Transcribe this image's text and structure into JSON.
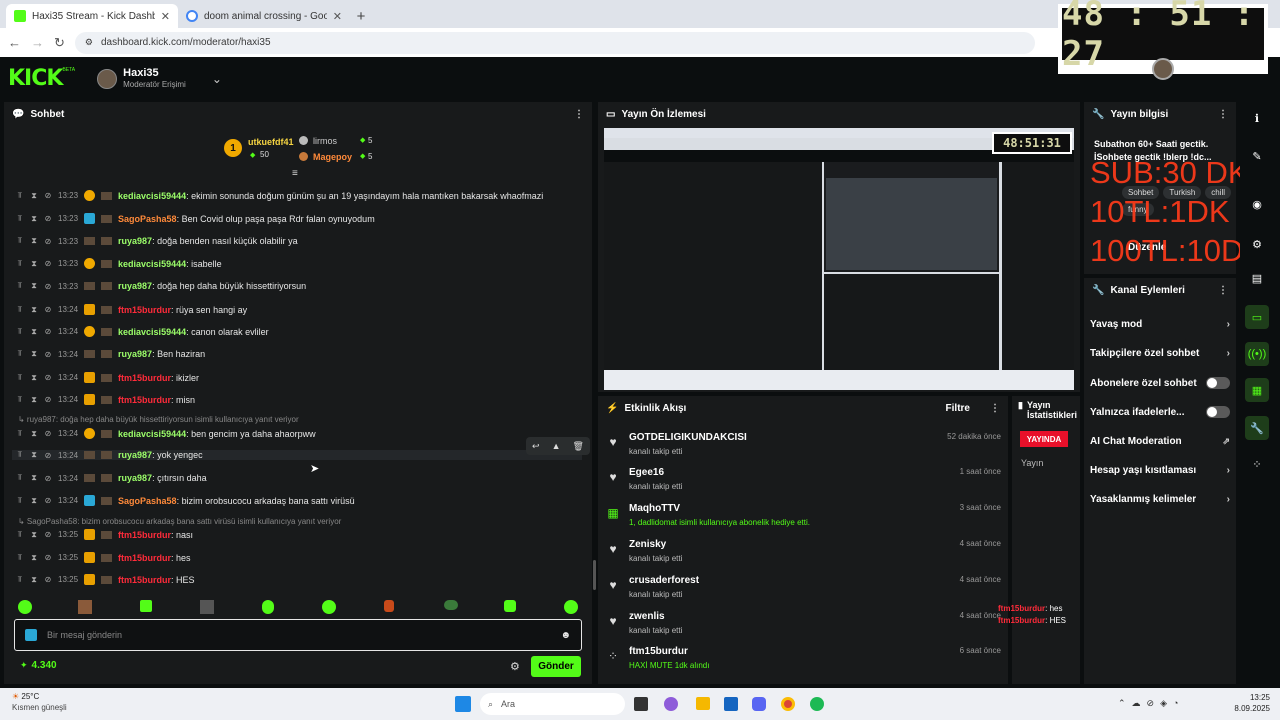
{
  "browser": {
    "tabs": [
      {
        "title": "Haxi35 Stream - Kick Dashboar",
        "active": true
      },
      {
        "title": "doom animal crossing - Google",
        "active": false
      }
    ],
    "url": "dashboard.kick.com/moderator/haxi35"
  },
  "header": {
    "logo": "KICK",
    "beta": "BETA",
    "username": "Haxi35",
    "role": "Moderatör Erişimi"
  },
  "timer": "48 : 51 : 27",
  "chat": {
    "title": "Sohbet",
    "leaders": [
      {
        "name": "utkuefdf41",
        "count": "50",
        "rank": "1"
      },
      {
        "name": "lirmos",
        "count": "5"
      },
      {
        "name": "Magepoy",
        "count": "5"
      }
    ],
    "messages": [
      {
        "time": "13:23",
        "user": "kediavcisi59444",
        "text": ": ekimin sonunda doğum günüm şu an 19 yaşındayım hala mantıken bakarsak whaofmazi"
      },
      {
        "time": "13:23",
        "user": "SagoPasha58",
        "text": ": Ben Covid olup paşa paşa Rdr falan oynuyodum"
      },
      {
        "time": "13:23",
        "user": "ruya987",
        "text": ": doğa benden nasıl küçük olabilir ya"
      },
      {
        "time": "13:23",
        "user": "kediavcisi59444",
        "text": ": isabelle"
      },
      {
        "time": "13:23",
        "user": "ruya987",
        "text": ": doğa hep daha büyük hissettiriyorsun"
      },
      {
        "time": "13:24",
        "user": "ftm15burdur",
        "text": ": rüya sen hangi ay"
      },
      {
        "time": "13:24",
        "user": "kediavcisi59444",
        "text": ": canon olarak evliler"
      },
      {
        "time": "13:24",
        "user": "ruya987",
        "text": ": Ben haziran"
      },
      {
        "time": "13:24",
        "user": "ftm15burdur",
        "text": ": ikizler"
      },
      {
        "time": "13:24",
        "user": "ftm15burdur",
        "text": ": misn"
      },
      {
        "time": "13:24",
        "user": "kediavcisi59444",
        "text": ": ben gencim ya daha ahaorpww"
      },
      {
        "time": "13:24",
        "user": "ruya987",
        "text": ": yok yengec"
      },
      {
        "time": "13:24",
        "user": "ruya987",
        "text": ": çıtırsın daha"
      },
      {
        "time": "13:24",
        "user": "SagoPasha58",
        "text": ": bizim orobsucocu arkadaş bana sattı virüsü"
      },
      {
        "time": "13:25",
        "user": "ftm15burdur",
        "text": ": nası"
      },
      {
        "time": "13:25",
        "user": "ftm15burdur",
        "text": ": hes"
      },
      {
        "time": "13:25",
        "user": "ftm15burdur",
        "text": ": HES"
      }
    ],
    "reply1": "↳ ruya987: doğa hep daha büyük hissettiriyorsun isimli kullanıcıya yanıt veriyor",
    "reply2": "↳ SagoPasha58: bizim orobsucocu arkadaş bana sattı virüsü isimli kullanıcıya yanıt veriyor",
    "placeholder": "Bir mesaj gönderin",
    "points": "4.340",
    "send": "Gönder"
  },
  "preview": {
    "title": "Yayın Ön İzlemesi",
    "mini_timer": "48:51:31"
  },
  "activity": {
    "title": "Etkinlik Akışı",
    "filter": "Filtre",
    "events": [
      {
        "name": "GOTDELIGIKUNDAKCISI",
        "desc": "kanalı takip etti",
        "time": "52 dakika önce"
      },
      {
        "name": "Egee16",
        "desc": "kanalı takip etti",
        "time": "1 saat önce"
      },
      {
        "name": "MaqhoTTV",
        "desc": "1, dadlidomat isimli kullanıcıya abonelik hediye etti.",
        "time": "3 saat önce"
      },
      {
        "name": "Zenisky",
        "desc": "kanalı takip etti",
        "time": "4 saat önce"
      },
      {
        "name": "crusaderforest",
        "desc": "kanalı takip etti",
        "time": "4 saat önce"
      },
      {
        "name": "zwenlis",
        "desc": "kanalı takip etti",
        "time": "4 saat önce"
      },
      {
        "name": "ftm15burdur",
        "desc": "HAXİ MUTE 1dk alındı",
        "time": "6 saat önce"
      }
    ]
  },
  "stats": {
    "title": "Yayın İstatistikleri",
    "live": "YAYINDA",
    "label": "Yayın"
  },
  "info": {
    "title": "Yayın bilgisi",
    "text": "Subathon 60+ Saati gectik. İSohbete gectik !blerp !dc...",
    "tags": [
      "Sohbet",
      "Turkish",
      "chill",
      "funny"
    ],
    "edit": "Düzenle"
  },
  "overlay": [
    "SUB:30 DK",
    "10TL:1DK",
    "100TL:10DK"
  ],
  "overlay_chat": [
    {
      "user": "ftm15burdur",
      "text": ": hes"
    },
    {
      "user": "ftm15burdur",
      "text": ": HES"
    }
  ],
  "channel": {
    "title": "Kanal Eylemleri",
    "actions": [
      {
        "label": "Yavaş mod",
        "type": "arrow"
      },
      {
        "label": "Takipçilere özel sohbet",
        "type": "arrow"
      },
      {
        "label": "Abonelere özel sohbet",
        "type": "toggle"
      },
      {
        "label": "Yalnızca ifadelerle...",
        "type": "toggle"
      },
      {
        "label": "AI Chat Moderation",
        "type": "ext"
      },
      {
        "label": "Hesap yaşı kısıtlaması",
        "type": "arrow"
      },
      {
        "label": "Yasaklanmış kelimeler",
        "type": "arrow"
      }
    ]
  },
  "taskbar": {
    "temp": "25°C",
    "weather": "Kısmen güneşli",
    "search": "Ara",
    "time": "13:25",
    "date": "8.09.2025"
  },
  "colors": {
    "kick_green": "#53fc18",
    "live_red": "#e8102a",
    "panel": "#181a1b"
  }
}
